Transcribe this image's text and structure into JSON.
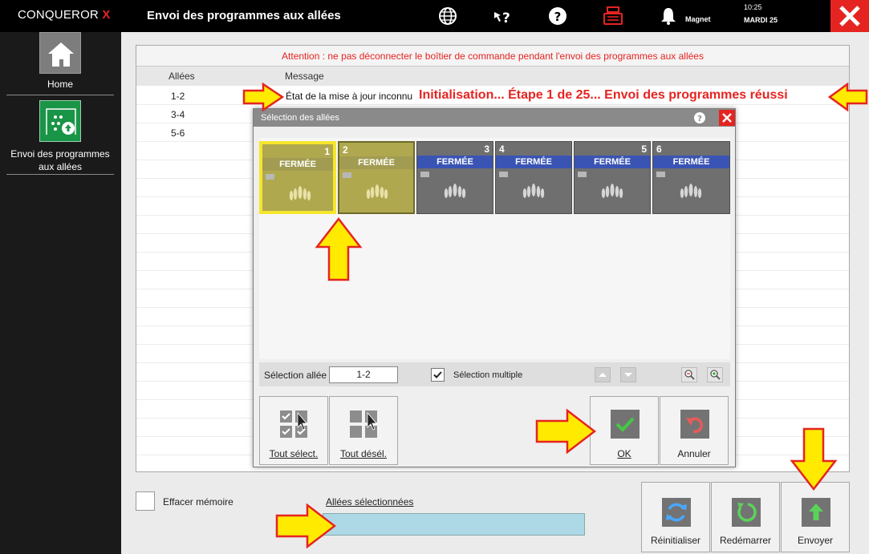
{
  "brand": {
    "name": "CONQUEROR",
    "suffix": "X"
  },
  "header": {
    "title": "Envoi des programmes aux allées",
    "user": "Magnet",
    "time": "10:25",
    "date": "MARDI 25"
  },
  "sidebar": {
    "items": [
      {
        "label": "Home",
        "icon": "home-icon"
      },
      {
        "label": "Envoi des programmes aux allées",
        "icon": "send-programs-icon"
      }
    ]
  },
  "main": {
    "warning": "Attention : ne pas déconnecter le boîtier de commande pendant l'envoi des programmes aux allées",
    "columns": [
      "Allées",
      "Message"
    ],
    "rows": [
      {
        "lanes": "1-2"
      },
      {
        "lanes": "3-4"
      },
      {
        "lanes": "5-6"
      }
    ],
    "status": "État de la mise à jour inconnu",
    "status_annotation": "Initialisation...  Étape 1 de 25...  Envoi des programmes réussi"
  },
  "dialog": {
    "title": "Sélection des allées",
    "lanes": [
      {
        "number": "1",
        "state": "FERMÉE",
        "selected": true
      },
      {
        "number": "2",
        "state": "FERMÉE",
        "selected": true
      },
      {
        "number": "3",
        "state": "FERMÉE",
        "selected": false
      },
      {
        "number": "4",
        "state": "FERMÉE",
        "selected": false
      },
      {
        "number": "5",
        "state": "FERMÉE",
        "selected": false
      },
      {
        "number": "6",
        "state": "FERMÉE",
        "selected": false
      }
    ],
    "selection_label": "Sélection allée",
    "selection_value": "1-2",
    "multi_label": "Sélection multiple",
    "multi_checked": true,
    "select_all": "Tout sélect.",
    "deselect_all": "Tout désél.",
    "ok": "OK",
    "cancel": "Annuler"
  },
  "bottom": {
    "clear_memory": "Effacer mémoire",
    "selected_lanes_label": "Allées sélectionnées",
    "selected_lanes_value": "",
    "reset": "Réinitialiser",
    "restart": "Redémarrer",
    "send": "Envoyer"
  },
  "colors": {
    "accent_red": "#e52421",
    "lane_selected": "#b0a84f",
    "lane_highlight": "#f5e62c",
    "state_blue": "#3a54b4",
    "selected_field": "#add8e6",
    "sidebar_green": "#1a9447",
    "arrow_yellow": "#ffea00"
  }
}
